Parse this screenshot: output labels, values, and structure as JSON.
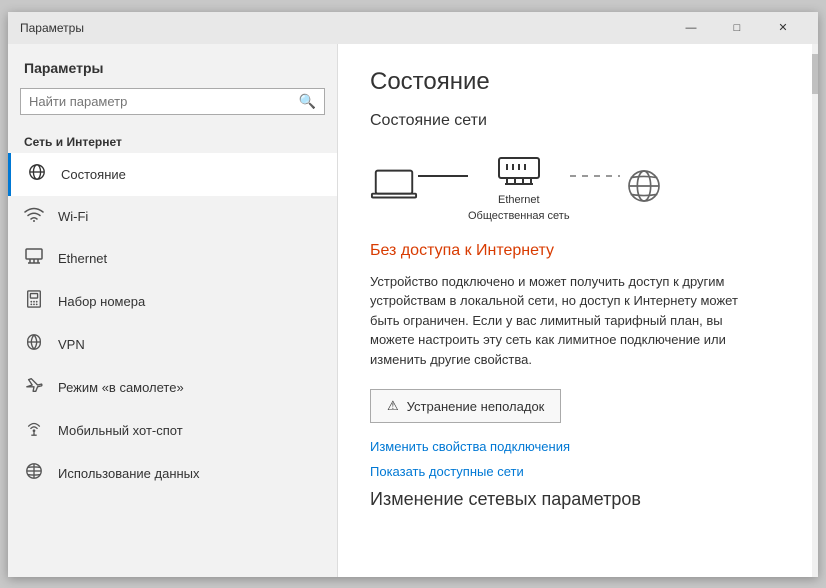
{
  "window": {
    "title": "Параметры",
    "controls": {
      "minimize": "—",
      "maximize": "□",
      "close": "✕"
    }
  },
  "sidebar": {
    "title": "Параметры",
    "search": {
      "placeholder": "Найти параметр"
    },
    "section": "Сеть и Интернет",
    "items": [
      {
        "id": "status",
        "label": "Состояние",
        "icon": "🌐",
        "active": true
      },
      {
        "id": "wifi",
        "label": "Wi-Fi",
        "icon": "📶"
      },
      {
        "id": "ethernet",
        "label": "Ethernet",
        "icon": "🖧"
      },
      {
        "id": "dialup",
        "label": "Набор номера",
        "icon": "📞"
      },
      {
        "id": "vpn",
        "label": "VPN",
        "icon": "🔒"
      },
      {
        "id": "airplane",
        "label": "Режим «в самолете»",
        "icon": "✈"
      },
      {
        "id": "hotspot",
        "label": "Мобильный хот-спот",
        "icon": "📡"
      },
      {
        "id": "data",
        "label": "Использование данных",
        "icon": "⚙"
      }
    ]
  },
  "main": {
    "page_title": "Состояние",
    "network_status_title": "Состояние сети",
    "ethernet_label": "Ethernet",
    "network_type": "Общественная сеть",
    "no_internet": "Без доступа к Интернету",
    "description": "Устройство подключено и может получить доступ к другим устройствам в локальной сети, но доступ к Интернету может быть ограничен. Если у вас лимитный тарифный план, вы можете настроить эту сеть как лимитное подключение или изменить другие свойства.",
    "troubleshoot_btn": "Устранение неполадок",
    "link1": "Изменить свойства подключения",
    "link2": "Показать доступные сети",
    "change_section": "Изменение сетевых параметров"
  }
}
